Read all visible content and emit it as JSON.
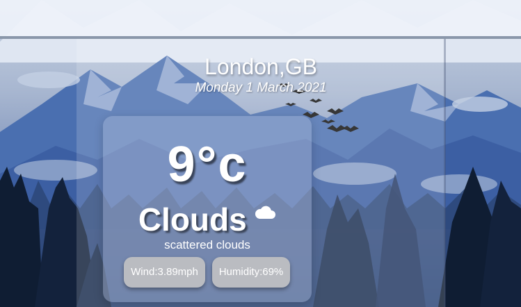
{
  "location": {
    "city": "London,GB",
    "date": "Monday 1 March 2021"
  },
  "weather": {
    "temperature": "9°c",
    "condition": "Clouds",
    "condition_icon": "cloud-icon",
    "description": "scattered clouds"
  },
  "stats": {
    "wind": "Wind:3.89mph",
    "humidity": "Humidity:69%"
  },
  "colors": {
    "text": "#ffffff",
    "pill": "#c4c4c4",
    "sky_top": "#c9d3e3",
    "mountain": "#4a6fb0",
    "forest": "#0f1d33"
  }
}
